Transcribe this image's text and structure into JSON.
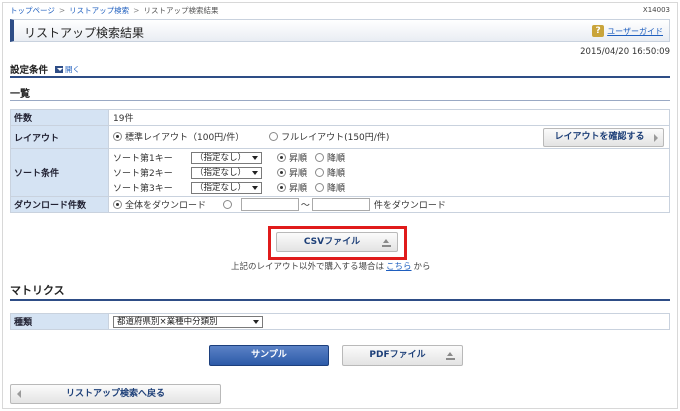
{
  "breadcrumb": {
    "items": [
      "トップページ",
      "リストアップ検索",
      "リストアップ検索結果"
    ],
    "separator": ">"
  },
  "screen_id": "X14003",
  "header": {
    "title": "リストアップ検索結果",
    "guide_icon": "?",
    "guide_label": "ユーザーガイド"
  },
  "datetime": "2015/04/20 16:50:09",
  "conditions": {
    "heading": "設定条件",
    "toggle_label": "開く"
  },
  "overview": {
    "heading": "一覧",
    "count_label": "件数",
    "count_value": "19件",
    "layout_label": "レイアウト",
    "layout_options": [
      "標準レイアウト（100円/件）",
      "フルレイアウト(150円/件)"
    ],
    "layout_selected": 0,
    "confirm_layout_button": "レイアウトを確認する",
    "sort_label": "ソート条件",
    "sort_rows": [
      {
        "label": "ソート第1キー",
        "selected": "（指定なし）",
        "asc": "昇順",
        "desc": "降順"
      },
      {
        "label": "ソート第2キー",
        "selected": "（指定なし）",
        "asc": "昇順",
        "desc": "降順"
      },
      {
        "label": "ソート第3キー",
        "selected": "（指定なし）",
        "asc": "昇順",
        "desc": "降順"
      }
    ],
    "download_label": "ダウンロード件数",
    "download_all": "全体をダウンロード",
    "download_range_sep": "〜",
    "download_range_suffix": "件をダウンロード"
  },
  "csv_button": "CSVファイル",
  "note": {
    "before": "上記のレイアウト以外で購入する場合は",
    "link": "こちら",
    "after": "から"
  },
  "matrix": {
    "heading": "マトリクス",
    "type_label": "種類",
    "type_selected": "都道府県別×業種中分類別",
    "sample_button": "サンプル",
    "pdf_button": "PDFファイル"
  },
  "back_button": "リストアップ検索へ戻る",
  "colors": {
    "accent": "#2e4d86",
    "label_bg": "#d5e3f3",
    "link": "#1f5fbf",
    "highlight": "#e01b1b"
  }
}
